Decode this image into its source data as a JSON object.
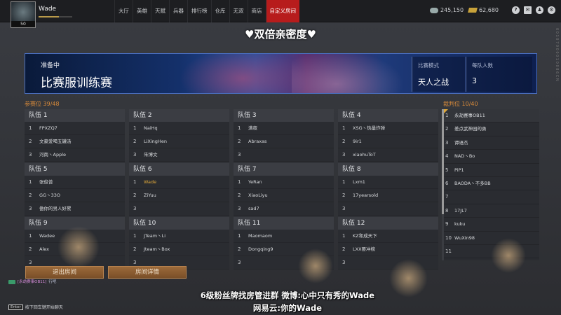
{
  "header": {
    "username": "Wade",
    "level": "50",
    "xp_progress": 0.6,
    "nav": [
      {
        "label": "大厅"
      },
      {
        "label": "英雄"
      },
      {
        "label": "天赋"
      },
      {
        "label": "兵器"
      },
      {
        "label": "排行榜"
      },
      {
        "label": "仓库"
      },
      {
        "label": "无双"
      },
      {
        "label": "商店"
      },
      {
        "label": "自定义房间"
      }
    ],
    "active_nav_index": 8,
    "currency_coin": "245,150",
    "currency_gold": "62,680",
    "system_icons": [
      "help-icon",
      "mail-icon",
      "friends-icon",
      "settings-icon"
    ]
  },
  "overlay_title": "♥双倍亲密度♥",
  "side_code": "0 0 1 0 7 0 0 0 0 1 0 0 8 6 C N",
  "banner": {
    "status": "准备中",
    "name": "比赛服训练赛",
    "mode_label": "比赛模式",
    "mode_value": "天人之战",
    "per_team_label": "每队人数",
    "per_team_value": "3"
  },
  "participants": {
    "label": "参赛位",
    "count": "39/48"
  },
  "referees_header": {
    "label": "裁判位",
    "count": "10/40"
  },
  "teams": [
    {
      "name": "队伍 1",
      "members": [
        "FPXZQ7",
        "文豪爱喝五罐汤",
        "河南丶Apple"
      ]
    },
    {
      "name": "队伍 2",
      "members": [
        "NaiHq",
        "LiXingHen",
        "朱博文"
      ]
    },
    {
      "name": "队伍 3",
      "members": [
        "满夜",
        "Abraxas",
        ""
      ]
    },
    {
      "name": "队伍 4",
      "members": [
        "XSG丶热量炸弹",
        "9ir1",
        "xiaohuToT"
      ]
    },
    {
      "name": "队伍 5",
      "members": [
        "张俊普",
        "GG丶33O",
        "傲你的男人好累"
      ]
    },
    {
      "name": "队伍 6",
      "members": [
        "Wade",
        "ZiYuu",
        ""
      ]
    },
    {
      "name": "队伍 7",
      "members": [
        "YeRan",
        "XiaoLiyu",
        "sad7"
      ]
    },
    {
      "name": "队伍 8",
      "members": [
        "Lxm1",
        "17yearsold",
        ""
      ]
    },
    {
      "name": "队伍 9",
      "members": [
        "Wadee",
        "Alex",
        ""
      ]
    },
    {
      "name": "队伍 10",
      "members": [
        "JTeam丶Li",
        "Jteam丶Box",
        ""
      ]
    },
    {
      "name": "队伍 11",
      "members": [
        "Maomaom",
        "Dongqing9",
        ""
      ]
    },
    {
      "name": "队伍 12",
      "members": [
        "KZ和成天下",
        "LXX要冲榜",
        ""
      ]
    }
  ],
  "current_user_slot": {
    "team": 5,
    "index": 0
  },
  "referees": [
    "永劫赛事OB11",
    "差点武神园的勇",
    "谭语杰",
    "NAD丶Bo",
    "PiP1",
    "BAODA丶不多BB",
    "",
    "17JL7",
    "kuku",
    "WuXin98",
    ""
  ],
  "buttons": {
    "leave": "退出房间",
    "details": "房间详情"
  },
  "chat": [
    {
      "sender": "[永劫赛事OB11]",
      "text": "行吧",
      "badge_color": "#3a9a6a"
    }
  ],
  "enter_hint": {
    "key": "Enter",
    "text": "按下回车键开始聊天"
  },
  "subtitles": [
    "6级粉丝牌找房管进群    微博:心中只有秀的Wade",
    "网易云:你的Wade"
  ]
}
